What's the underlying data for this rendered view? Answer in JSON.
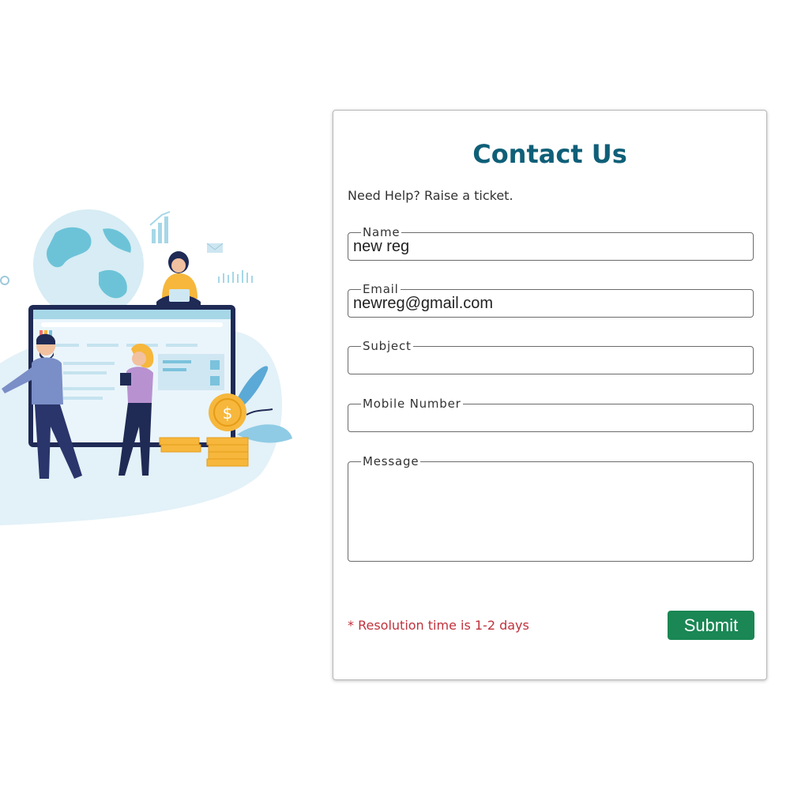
{
  "form": {
    "title": "Contact Us",
    "subtitle": "Need Help? Raise a ticket.",
    "fields": {
      "name": {
        "label": "Name",
        "value": "new reg"
      },
      "email": {
        "label": "Email",
        "value": "newreg@gmail.com"
      },
      "subject": {
        "label": "Subject",
        "value": ""
      },
      "mobile": {
        "label": "Mobile Number",
        "value": ""
      },
      "message": {
        "label": "Message",
        "value": ""
      }
    },
    "note": "* Resolution time is 1-2 days",
    "submit_label": "Submit"
  },
  "colors": {
    "title": "#0f5f78",
    "submit_bg": "#1a8754",
    "note": "#c0323c"
  }
}
